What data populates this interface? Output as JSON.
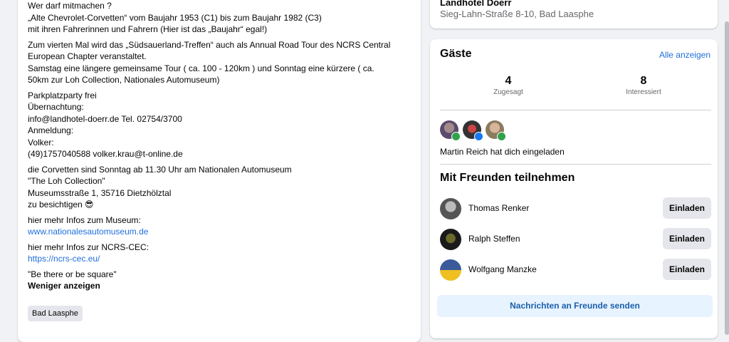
{
  "description": {
    "p1": [
      "Wer darf mitmachen ?",
      "„Alte Chevrolet-Corvetten“ vom Baujahr 1953 (C1) bis zum Baujahr 1982 (C3)",
      "mit ihren Fahrerinnen und Fahrern (Hier ist das „Baujahr“ egal!)"
    ],
    "p2": [
      "Zum vierten Mal wird das „Südsauerland-Treffen“ auch als Annual Road Tour des NCRS Central",
      "European Chapter veranstaltet.",
      "Samstag eine längere gemeinsame Tour ( ca. 100 - 120km ) und Sonntag eine kürzere ( ca.",
      "50km zur Loh Collection, Nationales Automuseum)"
    ],
    "p3": [
      "Parkplatzparty frei",
      "Übernachtung:",
      "info@landhotel-doerr.de Tel. 02754/3700",
      "Anmeldung:",
      "Volker:",
      "(49)1757040588 volker.krau@t-online.de"
    ],
    "p4": [
      "die Corvetten sind Sonntag ab 11.30 Uhr am Nationalen Automuseum",
      "\"The Loh Collection\"",
      "Museumsstraße 1, 35716 Dietzhölztal",
      "zu besichtigen 😎"
    ],
    "p5_label": "hier mehr Infos zum Museum:",
    "p5_link": "www.nationalesautomuseum.de",
    "p6_label": "hier mehr Infos zur NCRS-CEC:",
    "p6_link": "https://ncrs-cec.eu/",
    "p7": "\"Be there or be square\"",
    "see_less": "Weniger anzeigen",
    "location_tag": "Bad Laasphe"
  },
  "venue": {
    "name": "Landhotel Doerr",
    "address": "Sieg-Lahn-Straße 8-10, Bad Laasphe"
  },
  "guests": {
    "title": "Gäste",
    "see_all": "Alle anzeigen",
    "going_count": "4",
    "going_label": "Zugesagt",
    "interested_count": "8",
    "interested_label": "Interessiert",
    "invited_by": "Martin Reich hat dich eingeladen"
  },
  "friends": {
    "title": "Mit Freunden teilnehmen",
    "items": [
      {
        "name": "Thomas Renker",
        "button": "Einladen"
      },
      {
        "name": "Ralph Steffen",
        "button": "Einladen"
      },
      {
        "name": "Wolfgang Manzke",
        "button": "Einladen"
      }
    ],
    "send_button": "Nachrichten an Freunde senden"
  },
  "colors": {
    "link": "#216fdb",
    "badge_green": "#31a24c",
    "badge_blue": "#1877f2",
    "send_button_bg": "#e7f3ff"
  }
}
